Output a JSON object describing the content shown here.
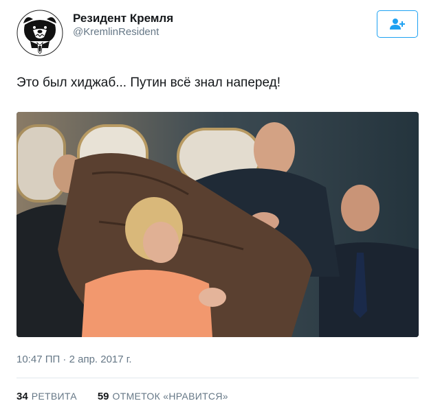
{
  "author": {
    "display_name": "Резидент Кремля",
    "handle": "@KremlinResident",
    "avatar_icon": "bear-in-tie-avatar"
  },
  "follow_button": {
    "icon": "add-user-icon",
    "color": "#1da1f2"
  },
  "tweet": {
    "text": "Это был хиджаб... Путин всё знал наперед!",
    "timestamp": "10:47 ПП · 2 апр. 2017 г."
  },
  "stats": {
    "retweets_count": "34",
    "retweets_label": "РЕТВИТА",
    "likes_count": "59",
    "likes_label": "ОТМЕТОК «НРАВИТСЯ»"
  }
}
